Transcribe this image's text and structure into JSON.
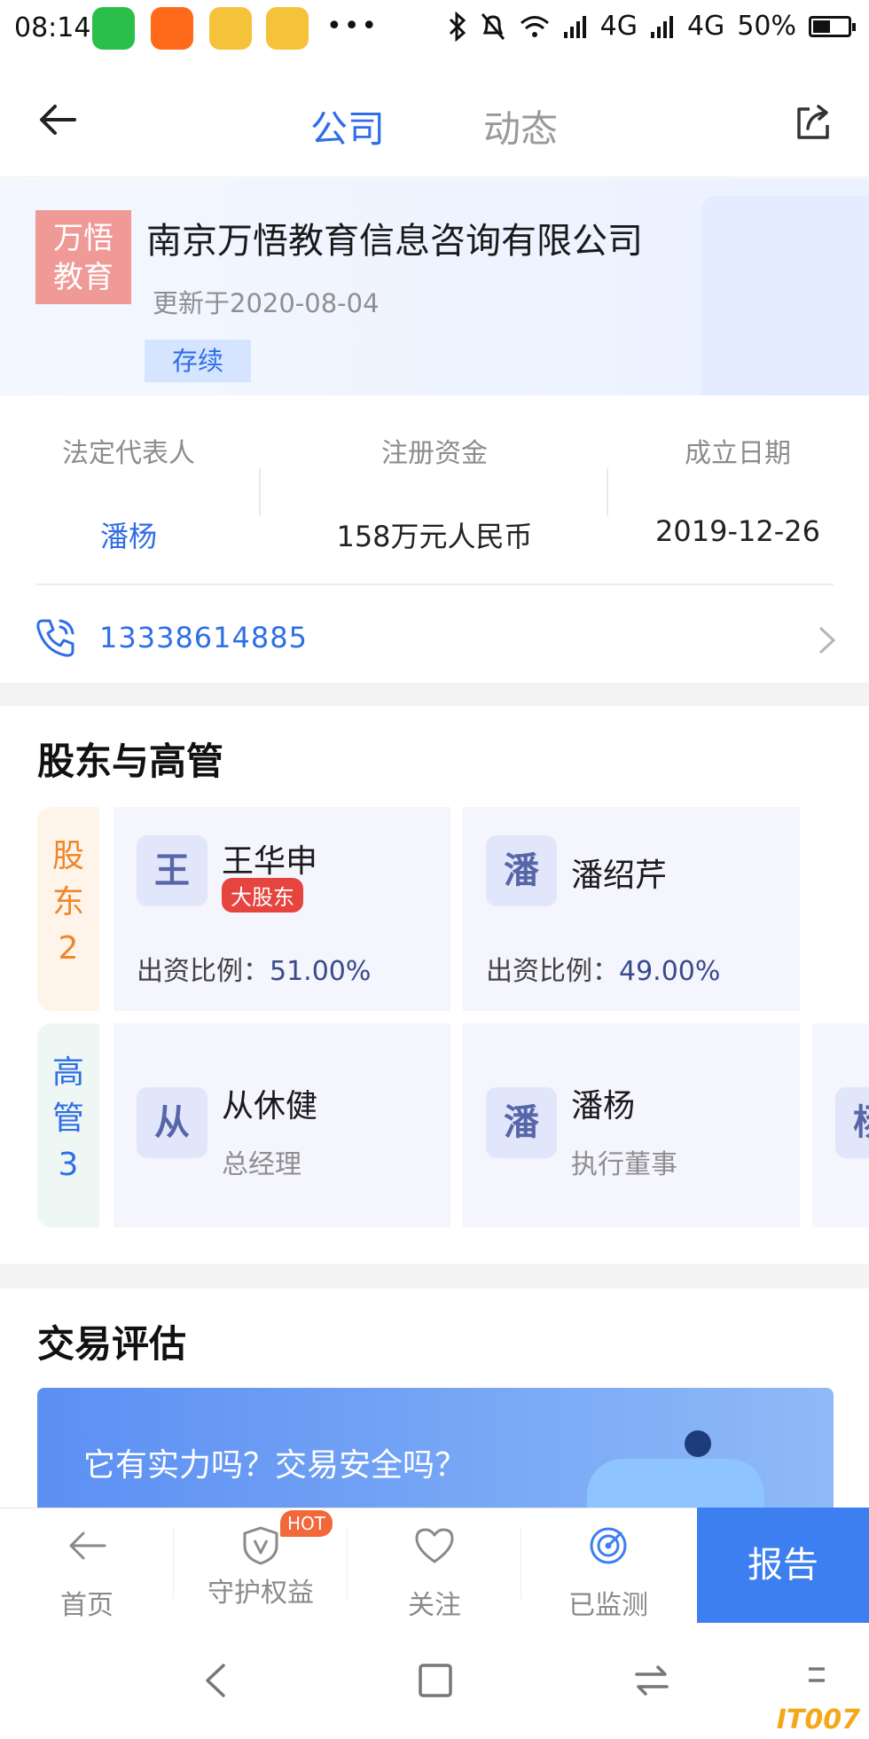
{
  "status_bar": {
    "time": "08:14",
    "more": "•••",
    "network1": "4G",
    "network2": "4G",
    "battery": "50%",
    "battery_level": 0.5
  },
  "nav": {
    "tab_company": "公司",
    "tab_dynamics": "动态"
  },
  "company": {
    "logo_line1": "万悟",
    "logo_line2": "教育",
    "name": "南京万悟教育信息咨询有限公司",
    "updated": "更新于2020-08-04",
    "status": "存续"
  },
  "info": {
    "legal_rep_label": "法定代表人",
    "legal_rep_value": "潘杨",
    "capital_label": "注册资金",
    "capital_value": "158万元人民币",
    "founded_label": "成立日期",
    "founded_value": "2019-12-26"
  },
  "phone": "13338614885",
  "shareholders_section": {
    "title": "股东与高管",
    "shareholders_label": [
      "股",
      "东",
      "2"
    ],
    "executives_label": [
      "高",
      "管",
      "3"
    ],
    "shareholders": [
      {
        "avatar": "王",
        "name": "王华申",
        "badge": "大股东",
        "ratio_label": "出资比例：",
        "ratio": "51.00%"
      },
      {
        "avatar": "潘",
        "name": "潘绍芹",
        "ratio_label": "出资比例：",
        "ratio": "49.00%"
      }
    ],
    "executives": [
      {
        "avatar": "从",
        "name": "从休健",
        "role": "总经理"
      },
      {
        "avatar": "潘",
        "name": "潘杨",
        "role": "执行董事"
      },
      {
        "avatar": "杨"
      }
    ]
  },
  "trade_section": {
    "title": "交易评估",
    "banner_text": "它有实力吗？交易安全吗？"
  },
  "tabbar": {
    "home": "首页",
    "protect": "守护权益",
    "hot": "HOT",
    "follow": "关注",
    "monitored": "已监测",
    "report": "报告"
  },
  "watermark": "IT007"
}
